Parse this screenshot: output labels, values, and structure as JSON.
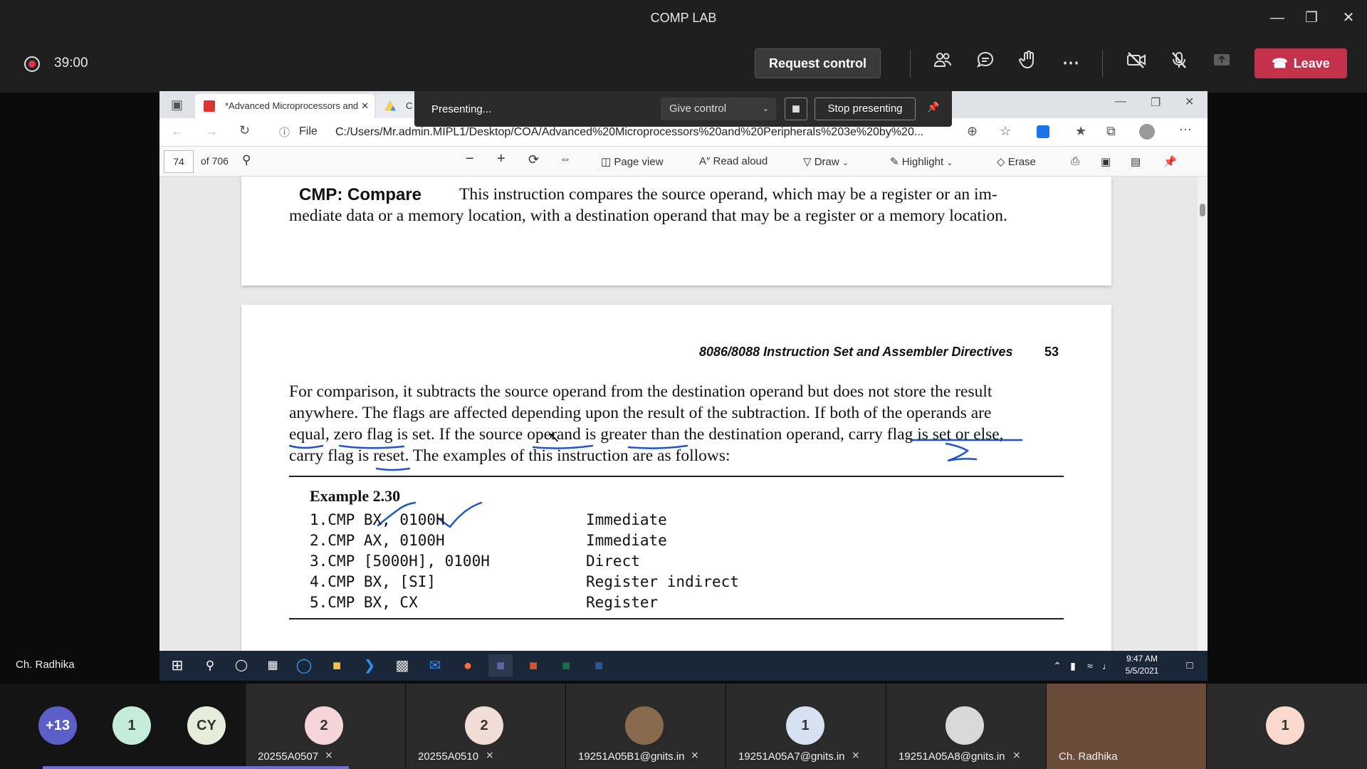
{
  "window": {
    "title": "COMP LAB"
  },
  "meeting": {
    "timer": "39:00",
    "request_control": "Request control",
    "leave": "Leave"
  },
  "presenter_bar": {
    "status": "Presenting...",
    "give_control": "Give control",
    "stop_presenting": "Stop presenting"
  },
  "browser": {
    "tab1": "*Advanced Microprocessors and",
    "tab2": "C",
    "file_label": "File",
    "url": "C:/Users/Mr.admin.MIPL1/Desktop/COA/Advanced%20Microprocessors%20and%20Peripherals%203e%20by%20..."
  },
  "pdf_toolbar": {
    "page_number": "74",
    "page_total": "of 706",
    "page_view": "Page view",
    "read_aloud": "Read aloud",
    "draw": "Draw",
    "highlight": "Highlight",
    "erase": "Erase"
  },
  "document": {
    "cmp_heading": "CMP: Compare",
    "cmp_text_line1": "This instruction compares the source operand, which may be a register or an im-",
    "cmp_text_line2": "mediate data or a memory location, with a destination operand that may be a register or a memory location.",
    "running_header": "8086/8088 Instruction Set and Assembler Directives",
    "page_no": "53",
    "para_line1": "For comparison, it subtracts the source operand from the destination operand but does not store the result",
    "para_line2": "anywhere. The flags are affected depending upon the result of the subtraction. If both of the operands are",
    "para_line3": "equal, zero flag is set. If the source operand is greater than the destination operand, carry flag is set or else,",
    "para_line4": "carry flag is reset. The examples of this instruction are as follows:",
    "example_title": "Example 2.30",
    "examples": [
      {
        "code": "1.CMP BX, 0100H",
        "mode": "Immediate"
      },
      {
        "code": "2.CMP AX, 0100H",
        "mode": "Immediate"
      },
      {
        "code": "3.CMP [5000H], 0100H",
        "mode": "Direct"
      },
      {
        "code": "4.CMP BX, [SI]",
        "mode": "Register indirect"
      },
      {
        "code": "5.CMP BX, CX",
        "mode": "Register"
      }
    ]
  },
  "taskbar": {
    "time": "9:47 AM",
    "date": "5/5/2021"
  },
  "presenter_name": "Ch. Radhika",
  "participants": [
    {
      "initials": "+13",
      "color": "#5b5fc7",
      "name": ""
    },
    {
      "initials": "1",
      "color": "#c4ecd8",
      "name": ""
    },
    {
      "initials": "CY",
      "color": "#e6eedb",
      "name": ""
    },
    {
      "initials": "2",
      "color": "#f6d5d8",
      "name": "20255A0507"
    },
    {
      "initials": "2",
      "color": "#f1dcd6",
      "name": "20255A0510"
    },
    {
      "initials": "",
      "color": "#8a6a4d",
      "name": "19251A05B1@gnits.in"
    },
    {
      "initials": "1",
      "color": "#d6e1f2",
      "name": "19251A05A7@gnits.in"
    },
    {
      "initials": "",
      "color": "#d8d8d8",
      "name": "19251A05A8@gnits.in"
    },
    {
      "initials": "",
      "color": "#7a4a3a",
      "name": "Ch. Radhika"
    },
    {
      "initials": "1",
      "color": "#fbd9cf",
      "name": ""
    }
  ]
}
